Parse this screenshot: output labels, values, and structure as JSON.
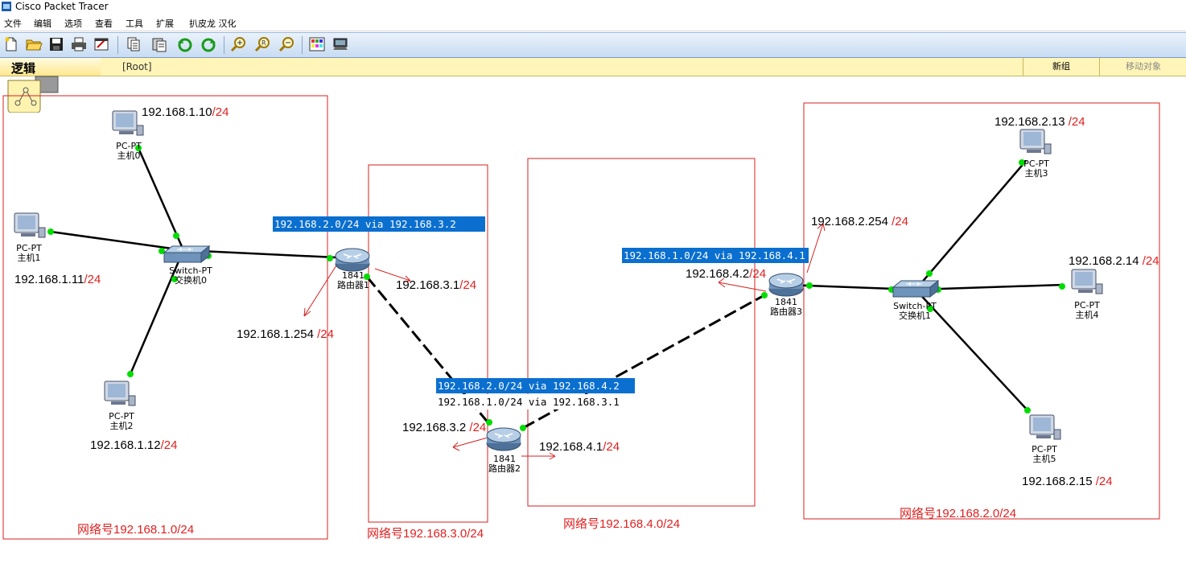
{
  "window": {
    "title": "Cisco Packet Tracer"
  },
  "menu": [
    "文件",
    "编辑",
    "选项",
    "查看",
    "工具",
    "扩展",
    "扒皮龙 汉化"
  ],
  "toolbar": {
    "icons": [
      "new-file-icon",
      "open-folder-icon",
      "save-icon",
      "print-icon",
      "activity-wizard-icon",
      "copy-icon",
      "paste-icon",
      "undo-icon",
      "redo-icon",
      "zoom-in-icon",
      "zoom-reset-icon",
      "zoom-out-icon",
      "palette-icon",
      "custom-device-icon"
    ]
  },
  "workspace": {
    "tab_label": "逻辑",
    "path": "[Root]",
    "new_cluster": "新组",
    "move_object": "移动对象"
  },
  "networks": [
    {
      "id": "n1",
      "label": "网络号192.168.1.0/24"
    },
    {
      "id": "n3",
      "label": "网络号192.168.3.0/24"
    },
    {
      "id": "n4",
      "label": "网络号192.168.4.0/24"
    },
    {
      "id": "n2",
      "label": "网络号192.168.2.0/24"
    }
  ],
  "devices": {
    "pc0": {
      "model": "PC-PT",
      "name": "主机0"
    },
    "pc1": {
      "model": "PC-PT",
      "name": "主机1"
    },
    "pc2": {
      "model": "PC-PT",
      "name": "主机2"
    },
    "pc3": {
      "model": "PC-PT",
      "name": "主机3"
    },
    "pc4": {
      "model": "PC-PT",
      "name": "主机4"
    },
    "pc5": {
      "model": "PC-PT",
      "name": "主机5"
    },
    "sw0": {
      "model": "Switch-PT",
      "name": "交换机0"
    },
    "sw1": {
      "model": "Switch-PT",
      "name": "交换机1"
    },
    "r1": {
      "model": "1841",
      "name": "路由器1"
    },
    "r2": {
      "model": "1841",
      "name": "路由器2"
    },
    "r3": {
      "model": "1841",
      "name": "路由器3"
    }
  },
  "ips": {
    "pc0": {
      "addr": "192.168.1.10",
      "mask": "/24"
    },
    "pc1": {
      "addr": "192.168.1.11",
      "mask": "/24"
    },
    "pc2": {
      "addr": "192.168.1.12",
      "mask": "/24"
    },
    "r1_g0": {
      "addr": "192.168.1.254",
      "mask": " /24"
    },
    "r1_g1": {
      "addr": "192.168.3.1",
      "mask": "/24"
    },
    "r2_g0": {
      "addr": "192.168.3.2",
      "mask": " /24"
    },
    "r2_g1": {
      "addr": "192.168.4.1",
      "mask": "/24"
    },
    "r3_g0": {
      "addr": "192.168.4.2",
      "mask": "/24"
    },
    "r3_g1": {
      "addr": "192.168.2.254",
      "mask": " /24"
    },
    "pc3": {
      "addr": "192.168.2.13",
      "mask": " /24"
    },
    "pc4": {
      "addr": "192.168.2.14",
      "mask": " /24"
    },
    "pc5": {
      "addr": "192.168.2.15",
      "mask": " /24"
    }
  },
  "routes": {
    "r1": "192.168.2.0/24 via 192.168.3.2",
    "r3": "192.168.1.0/24 via 192.168.4.1",
    "r2_a": "192.168.2.0/24 via 192.168.4.2",
    "r2_b": "192.168.1.0/24 via 192.168.3.1"
  },
  "colors": {
    "annotation": "#e02020",
    "link_up": "#00dd00",
    "selection": "#0a6fcf",
    "workspace_bar": "#fff5b8"
  }
}
